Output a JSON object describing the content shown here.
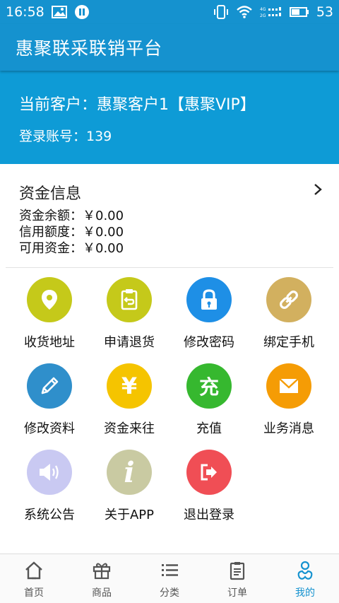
{
  "status_bar": {
    "time": "16:58",
    "battery": "53"
  },
  "header": {
    "title": "惠聚联采联销平台"
  },
  "customer": {
    "current_customer": "当前客户：惠聚客户1【惠聚VIP】",
    "login_account": "登录账号：139"
  },
  "funds": {
    "title": "资金信息",
    "balance": "资金余额：￥0.00",
    "credit_limit": "信用额度：￥0.00",
    "available": "可用资金：￥0.00"
  },
  "menu": [
    {
      "label": "收货地址",
      "icon": "location-icon",
      "color": "#c5c91a"
    },
    {
      "label": "申请退货",
      "icon": "return-clipboard-icon",
      "color": "#c5c91a"
    },
    {
      "label": "修改密码",
      "icon": "lock-icon",
      "color": "#1e8fe6"
    },
    {
      "label": "绑定手机",
      "icon": "link-icon",
      "color": "#d2b05f"
    },
    {
      "label": "修改资料",
      "icon": "pencil-icon",
      "color": "#2f8fcb"
    },
    {
      "label": "资金来往",
      "icon": "yuan-icon",
      "color": "#f5c400",
      "glyph": "¥"
    },
    {
      "label": "充值",
      "icon": "recharge-icon",
      "color": "#36b82f",
      "glyph": "充"
    },
    {
      "label": "业务消息",
      "icon": "message-icon",
      "color": "#f59c05"
    },
    {
      "label": "系统公告",
      "icon": "speaker-icon",
      "color": "#c9c9f2"
    },
    {
      "label": "关于APP",
      "icon": "info-icon",
      "color": "#c9caa2",
      "glyph": "i"
    },
    {
      "label": "退出登录",
      "icon": "logout-icon",
      "color": "#f04e55"
    }
  ],
  "bottom_nav": [
    {
      "label": "首页",
      "icon": "home-icon"
    },
    {
      "label": "商品",
      "icon": "gift-icon"
    },
    {
      "label": "分类",
      "icon": "list-icon"
    },
    {
      "label": "订单",
      "icon": "order-icon"
    },
    {
      "label": "我的",
      "icon": "profile-icon",
      "active": true
    }
  ]
}
